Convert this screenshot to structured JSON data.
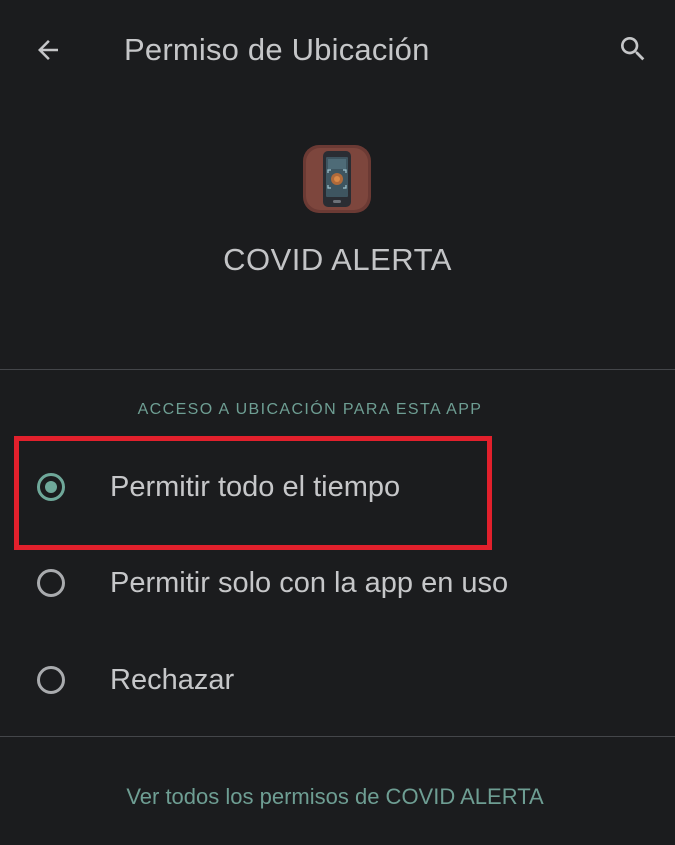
{
  "header": {
    "title": "Permiso de Ubicación",
    "back_icon": "arrow-left-icon",
    "search_icon": "search-icon"
  },
  "app": {
    "name": "COVID ALERTA",
    "icon": "covid-alerta-app-icon"
  },
  "location_access": {
    "section_header": "ACCESO A UBICACIÓN PARA ESTA APP",
    "options": [
      {
        "label": "Permitir todo el tiempo",
        "selected": true
      },
      {
        "label": "Permitir solo con la app en uso",
        "selected": false
      },
      {
        "label": "Rechazar",
        "selected": false
      }
    ],
    "highlighted_option": "Permitir todo el tiempo"
  },
  "footer": {
    "link_text": "Ver todos los permisos de COVID ALERTA"
  },
  "colors": {
    "background": "#1b1c1e",
    "accent": "#6fa89a",
    "highlight": "#e2202c",
    "text": "#c6c7c9",
    "divider": "#44464a"
  }
}
